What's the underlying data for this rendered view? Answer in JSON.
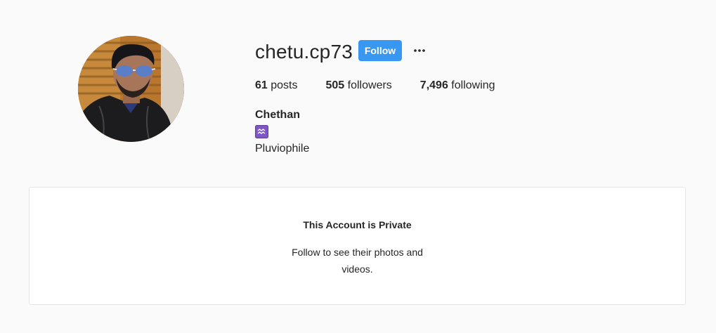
{
  "profile": {
    "username": "chetu.cp73",
    "follow_label": "Follow",
    "more_options_icon": "ellipsis-icon",
    "stats": {
      "posts_count": "61",
      "posts_label": "posts",
      "followers_count": "505",
      "followers_label": "followers",
      "following_count": "7,496",
      "following_label": "following"
    },
    "full_name": "Chethan",
    "bio_emoji_icon": "aquarius-icon",
    "bio_text": "Pluviophile"
  },
  "private_notice": {
    "title": "This Account is Private",
    "message": "Follow to see their photos and videos."
  },
  "colors": {
    "background": "#fafafa",
    "accent": "#3897f0",
    "card": "#ffffff",
    "text": "#262626",
    "emoji_bg": "#7e57c2"
  }
}
